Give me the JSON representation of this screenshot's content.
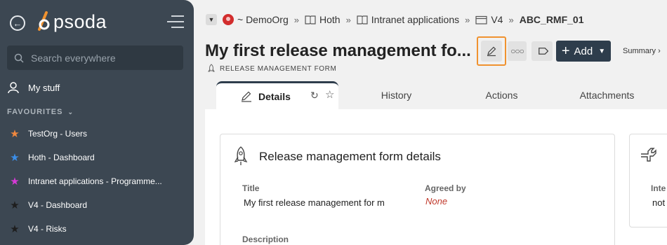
{
  "app": {
    "logo_text": "psoda"
  },
  "sidebar": {
    "search_placeholder": "Search everywhere",
    "mystuff_label": "My stuff",
    "favourites_header": "FAVOURITES",
    "favourites": [
      {
        "label": "TestOrg - Users",
        "star_color": "#f0883e"
      },
      {
        "label": "Hoth - Dashboard",
        "star_color": "#3b8ee8"
      },
      {
        "label": "Intranet applications - Programme...",
        "star_color": "#d63ad6"
      },
      {
        "label": "V4 - Dashboard",
        "star_color": "#1e1e1e"
      },
      {
        "label": "V4 - Risks",
        "star_color": "#1e1e1e"
      }
    ]
  },
  "breadcrumb": {
    "items": [
      {
        "label": "~ DemoOrg",
        "icon": "org-avatar-icon"
      },
      {
        "label": "Hoth",
        "icon": "book-icon"
      },
      {
        "label": "Intranet applications",
        "icon": "book-icon"
      },
      {
        "label": "V4",
        "icon": "window-icon"
      },
      {
        "label": "ABC_RMF_01",
        "icon": ""
      }
    ],
    "separator": "»"
  },
  "header": {
    "title": "My first release management fo...",
    "form_type": "RELEASE MANAGEMENT FORM",
    "add_label": "Add",
    "summary_label": "Summary ›"
  },
  "tabs": [
    {
      "label": "Details",
      "active": true
    },
    {
      "label": "History",
      "active": false
    },
    {
      "label": "Actions",
      "active": false
    },
    {
      "label": "Attachments",
      "active": false
    }
  ],
  "details_card": {
    "title": "Release management form details",
    "title_label": "Title",
    "title_value": "My first release management for m",
    "agreed_label": "Agreed by",
    "agreed_value": "None",
    "description_label": "Description"
  },
  "side_card": {
    "label": "Inte",
    "value": "not"
  },
  "colors": {
    "sidebar_bg": "#3c4752",
    "accent_orange": "#f0922f",
    "add_button_bg": "#2e3d4c",
    "none_red": "#c0392b"
  }
}
